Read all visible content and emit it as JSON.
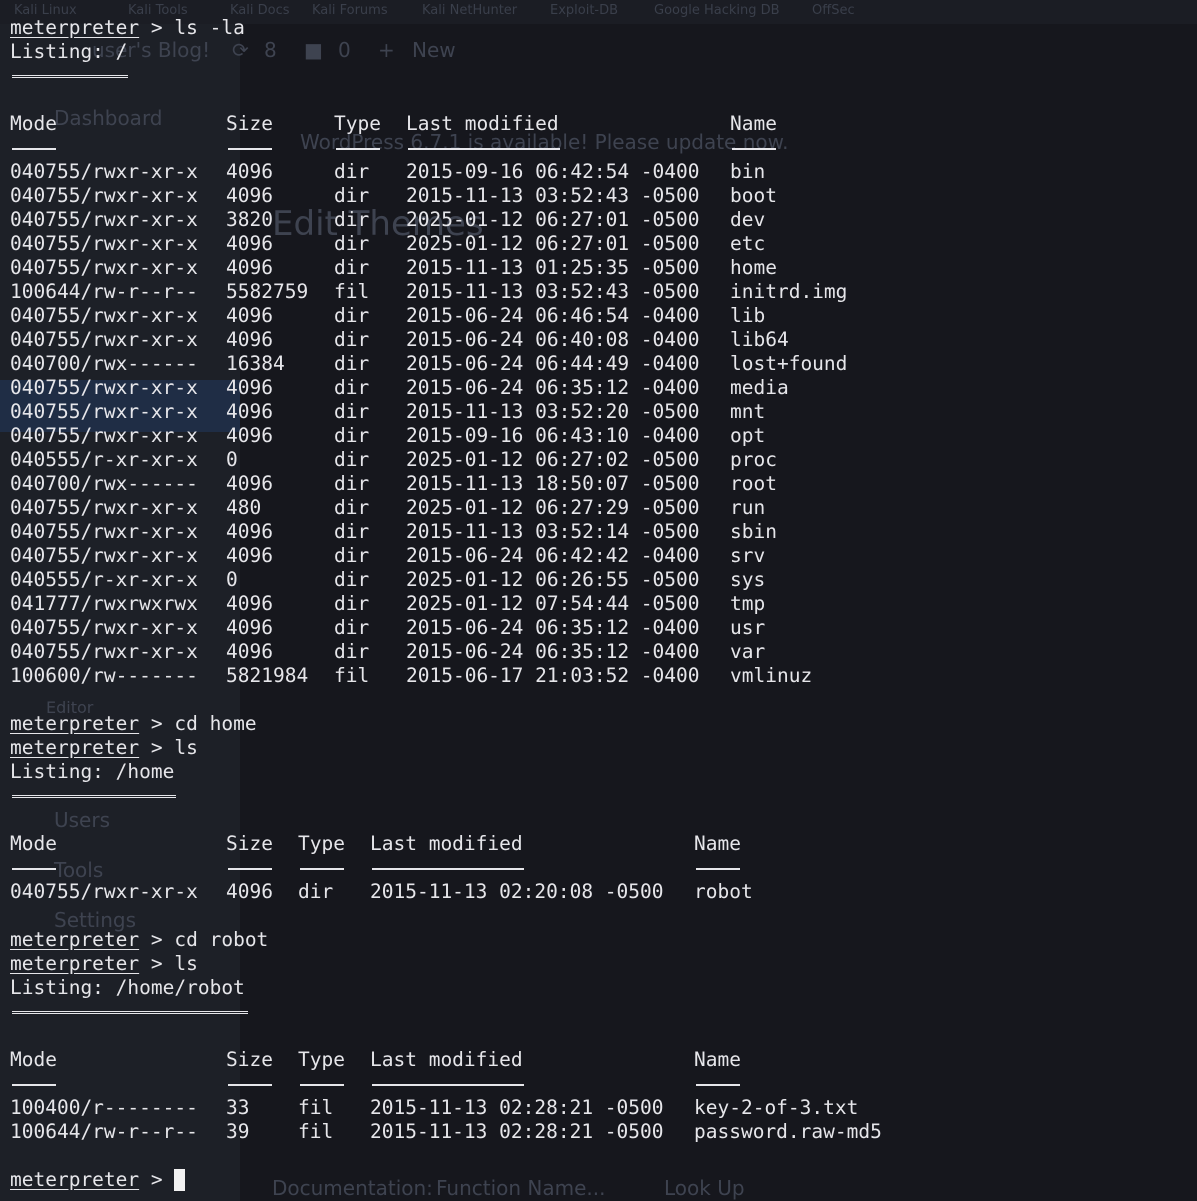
{
  "background": {
    "tabs": [
      "Kali Linux",
      "Kali Tools",
      "Kali Docs",
      "Kali Forums",
      "Kali NetHunter",
      "Exploit-DB",
      "Google Hacking DB",
      "OffSec"
    ],
    "blog_title": "user's Blog!",
    "updates_count": "8",
    "comments_count": "0",
    "new_label": "New",
    "dashboard": "Dashboard",
    "notice": "WordPress 6.7.1 is available! Please update now.",
    "edit_heading": "Edit Themes",
    "editor": "Editor",
    "users": "Users",
    "tools": "Tools",
    "settings": "Settings",
    "documentation_label": "Documentation:",
    "function_placeholder": "Function Name...",
    "lookup_label": "Look Up"
  },
  "terminal": {
    "prompt": "meterpreter",
    "blocks": [
      {
        "commands": [
          "ls -la"
        ],
        "listing": "Listing: /",
        "headers": [
          "Mode",
          "Size",
          "Type",
          "Last modified",
          "Name"
        ],
        "rows": [
          [
            "040755/rwxr-xr-x",
            "4096",
            "dir",
            "2015-09-16 06:42:54 -0400",
            "bin"
          ],
          [
            "040755/rwxr-xr-x",
            "4096",
            "dir",
            "2015-11-13 03:52:43 -0500",
            "boot"
          ],
          [
            "040755/rwxr-xr-x",
            "3820",
            "dir",
            "2025-01-12 06:27:01 -0500",
            "dev"
          ],
          [
            "040755/rwxr-xr-x",
            "4096",
            "dir",
            "2025-01-12 06:27:01 -0500",
            "etc"
          ],
          [
            "040755/rwxr-xr-x",
            "4096",
            "dir",
            "2015-11-13 01:25:35 -0500",
            "home"
          ],
          [
            "100644/rw-r--r--",
            "5582759",
            "fil",
            "2015-11-13 03:52:43 -0500",
            "initrd.img"
          ],
          [
            "040755/rwxr-xr-x",
            "4096",
            "dir",
            "2015-06-24 06:46:54 -0400",
            "lib"
          ],
          [
            "040755/rwxr-xr-x",
            "4096",
            "dir",
            "2015-06-24 06:40:08 -0400",
            "lib64"
          ],
          [
            "040700/rwx------",
            "16384",
            "dir",
            "2015-06-24 06:44:49 -0400",
            "lost+found"
          ],
          [
            "040755/rwxr-xr-x",
            "4096",
            "dir",
            "2015-06-24 06:35:12 -0400",
            "media"
          ],
          [
            "040755/rwxr-xr-x",
            "4096",
            "dir",
            "2015-11-13 03:52:20 -0500",
            "mnt"
          ],
          [
            "040755/rwxr-xr-x",
            "4096",
            "dir",
            "2015-09-16 06:43:10 -0400",
            "opt"
          ],
          [
            "040555/r-xr-xr-x",
            "0",
            "dir",
            "2025-01-12 06:27:02 -0500",
            "proc"
          ],
          [
            "040700/rwx------",
            "4096",
            "dir",
            "2015-11-13 18:50:07 -0500",
            "root"
          ],
          [
            "040755/rwxr-xr-x",
            "480",
            "dir",
            "2025-01-12 06:27:29 -0500",
            "run"
          ],
          [
            "040755/rwxr-xr-x",
            "4096",
            "dir",
            "2015-11-13 03:52:14 -0500",
            "sbin"
          ],
          [
            "040755/rwxr-xr-x",
            "4096",
            "dir",
            "2015-06-24 06:42:42 -0400",
            "srv"
          ],
          [
            "040555/r-xr-xr-x",
            "0",
            "dir",
            "2025-01-12 06:26:55 -0500",
            "sys"
          ],
          [
            "041777/rwxrwxrwx",
            "4096",
            "dir",
            "2025-01-12 07:54:44 -0500",
            "tmp"
          ],
          [
            "040755/rwxr-xr-x",
            "4096",
            "dir",
            "2015-06-24 06:35:12 -0400",
            "usr"
          ],
          [
            "040755/rwxr-xr-x",
            "4096",
            "dir",
            "2015-06-24 06:35:12 -0400",
            "var"
          ],
          [
            "100600/rw-------",
            "5821984",
            "fil",
            "2015-06-17 21:03:52 -0400",
            "vmlinuz"
          ]
        ]
      },
      {
        "commands": [
          "cd home",
          "ls"
        ],
        "listing": "Listing: /home",
        "headers": [
          "Mode",
          "Size",
          "Type",
          "Last modified",
          "Name"
        ],
        "rows": [
          [
            "040755/rwxr-xr-x",
            "4096",
            "dir",
            "2015-11-13 02:20:08 -0500",
            "robot"
          ]
        ]
      },
      {
        "commands": [
          "cd robot",
          "ls"
        ],
        "listing": "Listing: /home/robot",
        "headers": [
          "Mode",
          "Size",
          "Type",
          "Last modified",
          "Name"
        ],
        "rows": [
          [
            "100400/r--------",
            "33",
            "fil",
            "2015-11-13 02:28:21 -0500",
            "key-2-of-3.txt"
          ],
          [
            "100644/rw-r--r--",
            "39",
            "fil",
            "2015-11-13 02:28:21 -0500",
            "password.raw-md5"
          ]
        ]
      }
    ],
    "prompt_sep": " > "
  }
}
